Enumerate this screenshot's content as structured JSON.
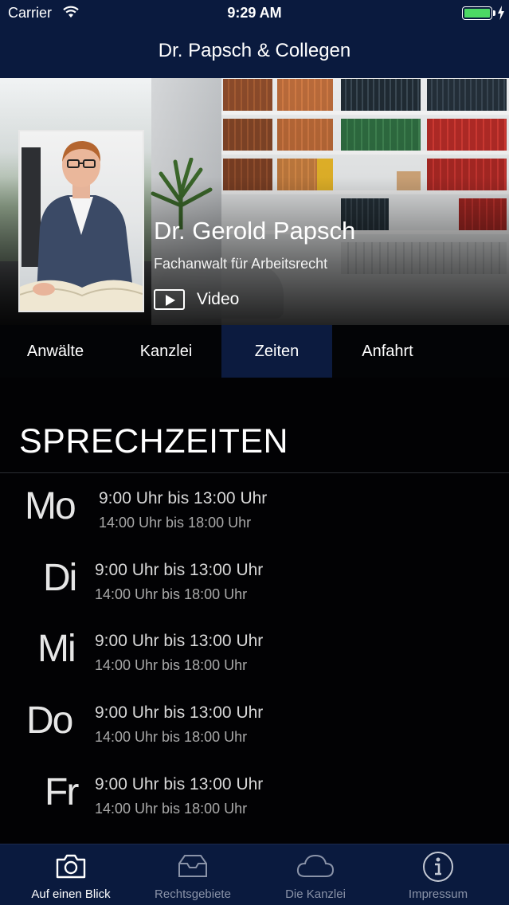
{
  "status_bar": {
    "carrier": "Carrier",
    "time": "9:29 AM"
  },
  "nav": {
    "title": "Dr. Papsch & Collegen"
  },
  "profile": {
    "name": "Dr. Gerold Papsch",
    "role": "Fachanwalt für Arbeitsrecht",
    "video_label": "Video"
  },
  "segments": [
    {
      "label": "Anwälte",
      "active": false
    },
    {
      "label": "Kanzlei",
      "active": false
    },
    {
      "label": "Zeiten",
      "active": true
    },
    {
      "label": "Anfahrt",
      "active": false
    }
  ],
  "section": {
    "title": "SPRECHZEITEN"
  },
  "hours": [
    {
      "day": "Mo",
      "slot1": "9:00 Uhr bis 13:00 Uhr",
      "slot2": "14:00 Uhr bis 18:00 Uhr"
    },
    {
      "day": "Di",
      "slot1": "9:00 Uhr bis 13:00 Uhr",
      "slot2": "14:00 Uhr bis 18:00 Uhr"
    },
    {
      "day": "Mi",
      "slot1": "9:00 Uhr bis 13:00 Uhr",
      "slot2": "14:00 Uhr bis 18:00 Uhr"
    },
    {
      "day": "Do",
      "slot1": "9:00 Uhr bis 13:00 Uhr",
      "slot2": "14:00 Uhr bis 18:00 Uhr"
    },
    {
      "day": "Fr",
      "slot1": "9:00 Uhr bis 13:00 Uhr",
      "slot2": "14:00 Uhr bis 18:00 Uhr"
    }
  ],
  "tabbar": [
    {
      "label": "Auf einen Blick",
      "icon": "camera-icon",
      "active": true
    },
    {
      "label": "Rechtsgebiete",
      "icon": "inbox-tray-icon",
      "active": false
    },
    {
      "label": "Die Kanzlei",
      "icon": "cloud-icon",
      "active": false
    },
    {
      "label": "Impressum",
      "icon": "info-icon",
      "active": false
    }
  ],
  "colors": {
    "nav_bg": "#0a1a3e",
    "active_segment": "#0c1b3f",
    "battery": "#4cd964",
    "content_bg": "#020204"
  }
}
